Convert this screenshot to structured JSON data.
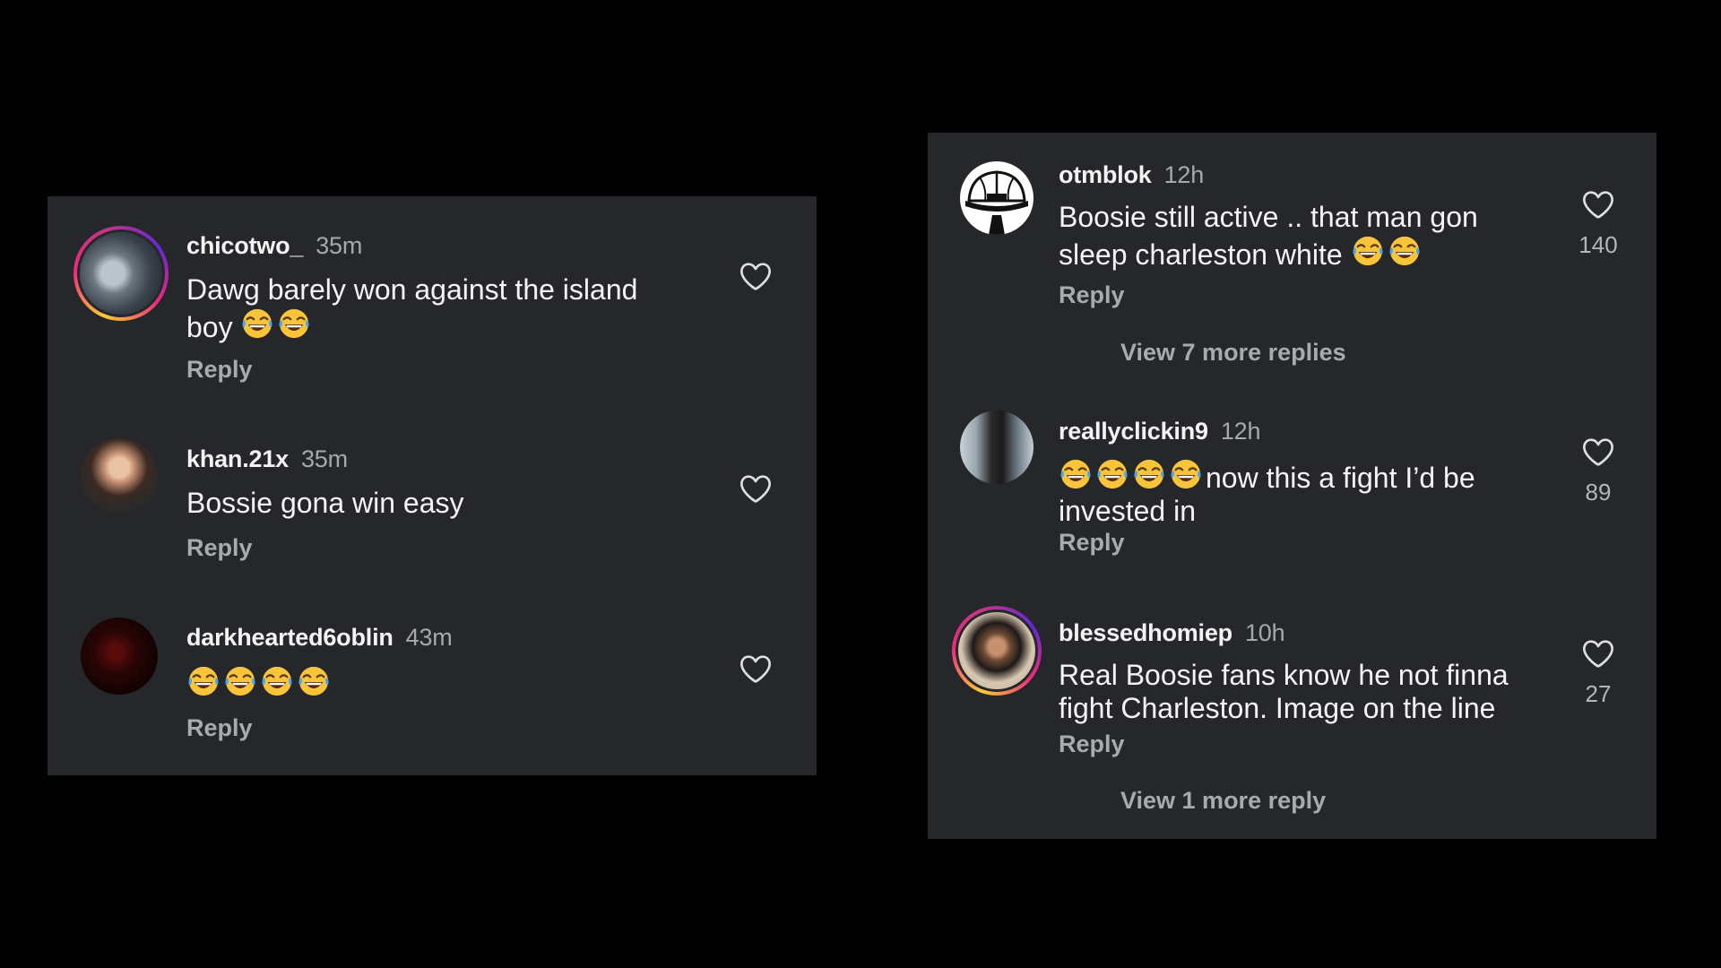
{
  "left_panel": {
    "comments": [
      {
        "username": "chicotwo_",
        "time": "35m",
        "text_line1": "Dawg barely won against the island",
        "text_line2": "boy",
        "emoji_count": 2,
        "reply_label": "Reply",
        "avatar_ring": true
      },
      {
        "username": "khan.21x",
        "time": "35m",
        "text_line1": "Bossie gona win easy",
        "reply_label": "Reply",
        "avatar_ring": false
      },
      {
        "username": "darkhearted6oblin",
        "time": "43m",
        "emoji_count": 4,
        "reply_label": "Reply",
        "avatar_ring": false
      }
    ]
  },
  "right_panel": {
    "comments": [
      {
        "username": "otmblok",
        "time": "12h",
        "text_line1": "Boosie still active .. that man gon",
        "text_line2": "sleep charleston white",
        "emoji_count": 2,
        "reply_label": "Reply",
        "likes": "140",
        "view_more": "View 7 more replies",
        "avatar_ring": false
      },
      {
        "username": "reallyclickin9",
        "time": "12h",
        "emoji_count": 4,
        "text_line1": "now this a fight I’d be",
        "text_line2": "invested in",
        "reply_label": "Reply",
        "likes": "89",
        "avatar_ring": false
      },
      {
        "username": "blessedhomiep",
        "time": "10h",
        "text_line1": "Real Boosie fans know he not finna",
        "text_line2": "fight Charleston. Image on the line",
        "reply_label": "Reply",
        "likes": "27",
        "view_more": "View 1 more reply",
        "avatar_ring": true
      }
    ]
  },
  "icons": {
    "like": "heart-outline-icon",
    "emoji": "face-with-tears-of-joy-icon"
  },
  "colors": {
    "page_background": "#000000",
    "panel_background": "#25272b",
    "primary_text": "#f4f4f4",
    "secondary_text": "#a8aaad",
    "story_ring_gradient": [
      "#f9ce34",
      "#ee2a7b",
      "#6228d7"
    ]
  }
}
